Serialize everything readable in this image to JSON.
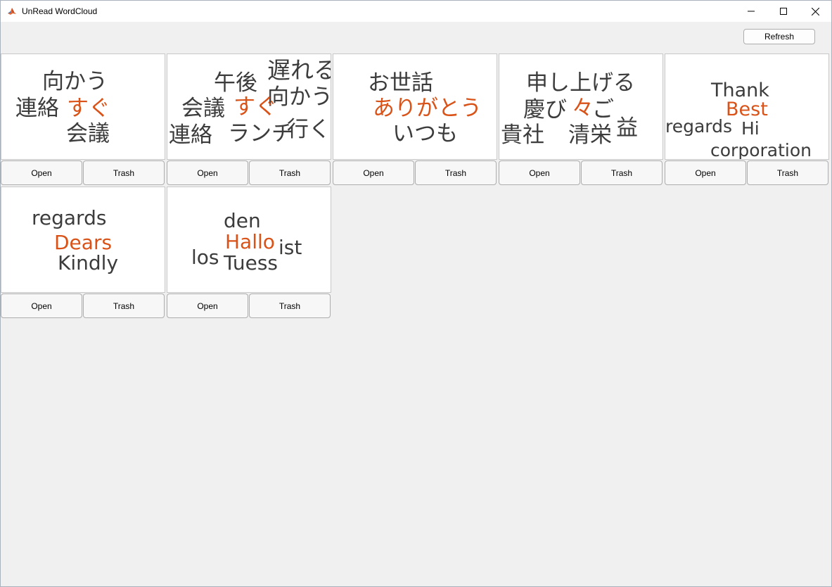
{
  "window": {
    "title": "UnRead WordCloud",
    "controls": [
      "minimize-icon",
      "maximize-icon",
      "close-icon"
    ]
  },
  "toolbar": {
    "refresh_label": "Refresh"
  },
  "colors": {
    "word": "#3c3c3c",
    "highlight": "#d95319"
  },
  "tiles": [
    {
      "words": [
        {
          "text": "向かう",
          "highlight": false
        },
        {
          "text": "連絡",
          "highlight": false
        },
        {
          "text": "すぐ",
          "highlight": true
        },
        {
          "text": "会議",
          "highlight": false
        }
      ],
      "open_label": "Open",
      "trash_label": "Trash"
    },
    {
      "words": [
        {
          "text": "遅れる",
          "highlight": false
        },
        {
          "text": "午後",
          "highlight": false
        },
        {
          "text": "向かう",
          "highlight": false
        },
        {
          "text": "会議",
          "highlight": false
        },
        {
          "text": "すぐ",
          "highlight": true
        },
        {
          "text": "連絡",
          "highlight": false
        },
        {
          "text": "ランチ",
          "highlight": false
        },
        {
          "text": "行く",
          "highlight": false
        }
      ],
      "open_label": "Open",
      "trash_label": "Trash"
    },
    {
      "words": [
        {
          "text": "お世話",
          "highlight": false
        },
        {
          "text": "ありがとう",
          "highlight": true
        },
        {
          "text": "いつも",
          "highlight": false
        }
      ],
      "open_label": "Open",
      "trash_label": "Trash"
    },
    {
      "words": [
        {
          "text": "申し上げる",
          "highlight": false
        },
        {
          "text": "慶び",
          "highlight": false
        },
        {
          "text": "々",
          "highlight": true
        },
        {
          "text": "ご",
          "highlight": false
        },
        {
          "text": "益",
          "highlight": false
        },
        {
          "text": "貴社",
          "highlight": false
        },
        {
          "text": "清栄",
          "highlight": false
        }
      ],
      "open_label": "Open",
      "trash_label": "Trash"
    },
    {
      "words": [
        {
          "text": "Thank",
          "highlight": false
        },
        {
          "text": "Best",
          "highlight": true
        },
        {
          "text": "regards",
          "highlight": false
        },
        {
          "text": "Hi",
          "highlight": false
        },
        {
          "text": "corporation",
          "highlight": false
        }
      ],
      "open_label": "Open",
      "trash_label": "Trash"
    },
    {
      "words": [
        {
          "text": "regards",
          "highlight": false
        },
        {
          "text": "Dears",
          "highlight": true
        },
        {
          "text": "Kindly",
          "highlight": false
        }
      ],
      "open_label": "Open",
      "trash_label": "Trash"
    },
    {
      "words": [
        {
          "text": "den",
          "highlight": false
        },
        {
          "text": "Hallo",
          "highlight": true
        },
        {
          "text": "ist",
          "highlight": false
        },
        {
          "text": "los",
          "highlight": false
        },
        {
          "text": "Tuess",
          "highlight": false
        }
      ],
      "open_label": "Open",
      "trash_label": "Trash"
    }
  ]
}
